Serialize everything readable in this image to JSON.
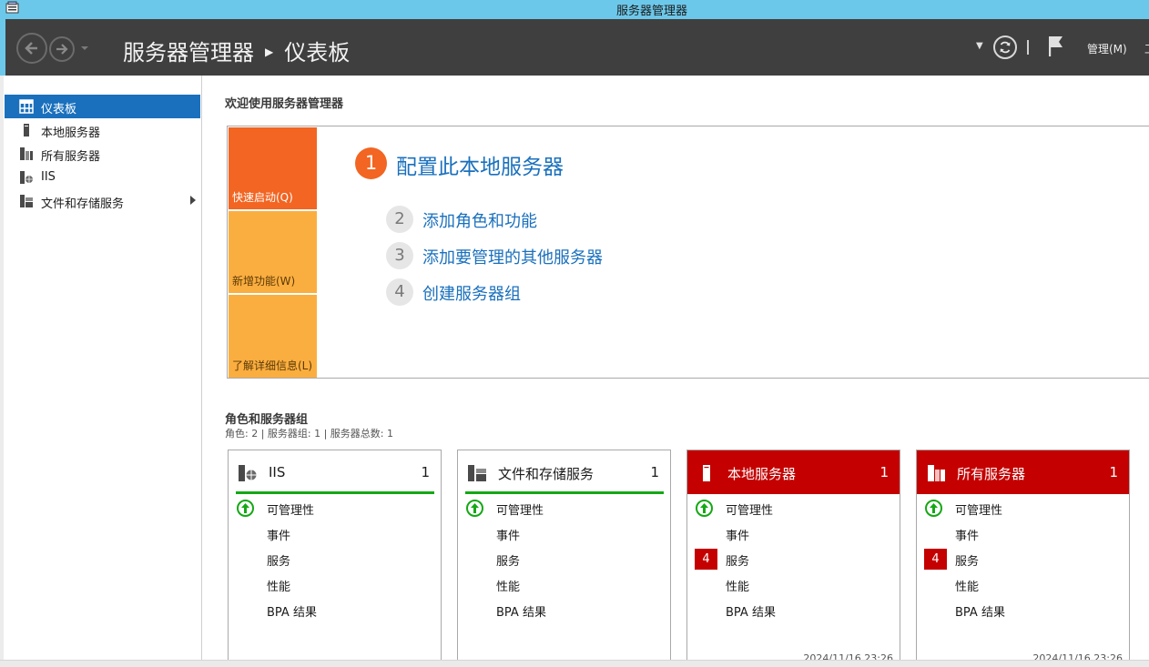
{
  "window": {
    "title": "服务器管理器"
  },
  "header": {
    "breadcrumb_app": "服务器管理器",
    "breadcrumb_page": "仪表板",
    "manage_menu": "管理(M)",
    "more_menu": "工"
  },
  "sidebar": {
    "items": [
      {
        "label": "仪表板",
        "icon": "dashboard-icon",
        "active": true
      },
      {
        "label": "本地服务器",
        "icon": "local-server-icon"
      },
      {
        "label": "所有服务器",
        "icon": "all-servers-icon"
      },
      {
        "label": "IIS",
        "icon": "iis-icon"
      },
      {
        "label": "文件和存储服务",
        "icon": "file-storage-icon",
        "has_arrow": true
      }
    ]
  },
  "welcome": {
    "title": "欢迎使用服务器管理器",
    "tiles": {
      "quick": "快速启动(Q)",
      "new": "新增功能(W)",
      "learn": "了解详细信息(L)"
    },
    "steps": [
      {
        "num": "1",
        "label": "配置此本地服务器"
      },
      {
        "num": "2",
        "label": "添加角色和功能"
      },
      {
        "num": "3",
        "label": "添加要管理的其他服务器"
      },
      {
        "num": "4",
        "label": "创建服务器组"
      }
    ]
  },
  "roles": {
    "title": "角色和服务器组",
    "subtitle": "角色: 2 | 服务器组: 1 | 服务器总数: 1",
    "row_labels": {
      "manageability": "可管理性",
      "events": "事件",
      "services": "服务",
      "performance": "性能",
      "bpa": "BPA 结果"
    },
    "cards": [
      {
        "name": "IIS",
        "count": "1",
        "status": "ok",
        "services_badge": "",
        "timestamp": ""
      },
      {
        "name": "文件和存储服务",
        "count": "1",
        "status": "ok",
        "services_badge": "",
        "timestamp": ""
      },
      {
        "name": "本地服务器",
        "count": "1",
        "status": "alert",
        "services_badge": "4",
        "timestamp": "2024/11/16 23:26"
      },
      {
        "name": "所有服务器",
        "count": "1",
        "status": "alert",
        "services_badge": "4",
        "timestamp": "2024/11/16 23:26"
      }
    ]
  },
  "colors": {
    "titlebar": "#6cc8ea",
    "header": "#3f3f3f",
    "accent_blue": "#1a70bd",
    "quick_start": "#f26522",
    "tile_yellow": "#fbae40",
    "alert_red": "#c40000",
    "ok_green": "#14a814"
  }
}
